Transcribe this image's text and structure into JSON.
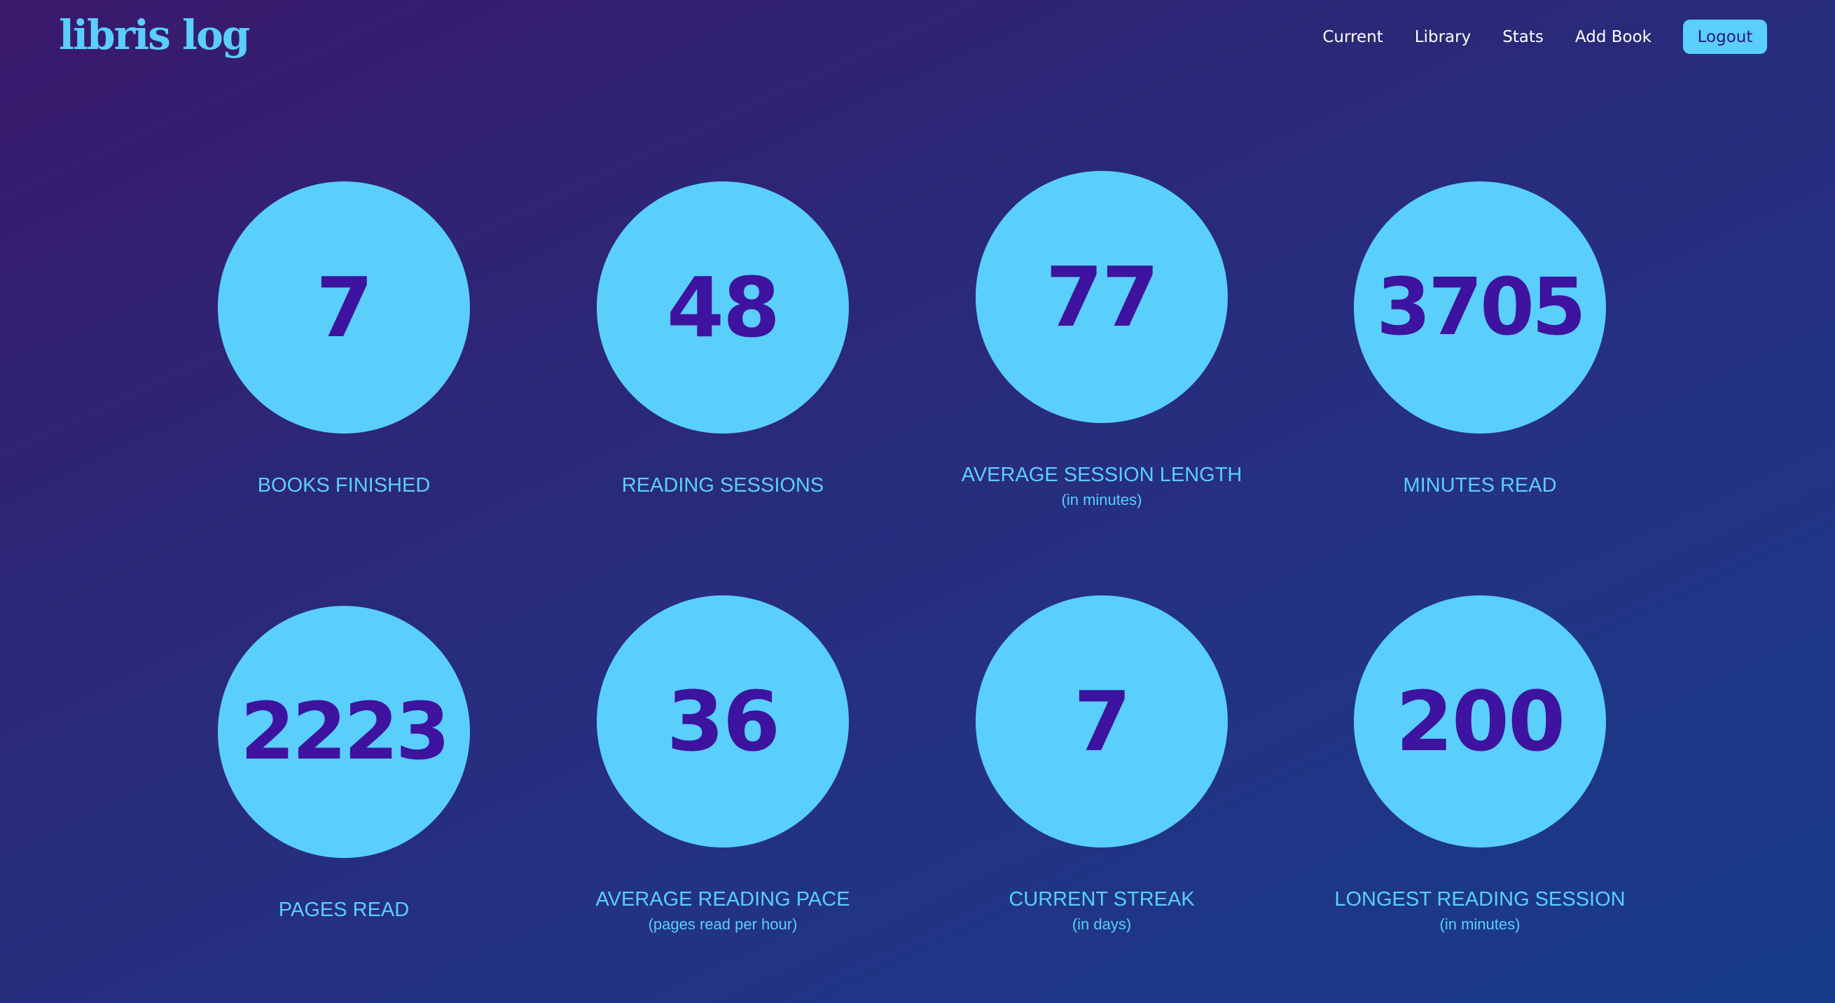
{
  "app": {
    "logo": "libris log"
  },
  "nav": {
    "items": [
      "Current",
      "Library",
      "Stats",
      "Add Book"
    ],
    "logout_label": "Logout"
  },
  "stats": [
    {
      "value": "7",
      "label": "BOOKS FINISHED",
      "sub": ""
    },
    {
      "value": "48",
      "label": "READING SESSIONS",
      "sub": ""
    },
    {
      "value": "77",
      "label": "AVERAGE SESSION LENGTH",
      "sub": "(in minutes)"
    },
    {
      "value": "3705",
      "label": "MINUTES READ",
      "sub": ""
    },
    {
      "value": "2223",
      "label": "PAGES READ",
      "sub": ""
    },
    {
      "value": "36",
      "label": "AVERAGE READING PACE",
      "sub": "(pages read per hour)"
    },
    {
      "value": "7",
      "label": "CURRENT STREAK",
      "sub": "(in days)"
    },
    {
      "value": "200",
      "label": "LONGEST READING SESSION",
      "sub": "(in minutes)"
    }
  ],
  "colors": {
    "accent": "#5acffc",
    "value_text": "#3d13a0",
    "background_start": "#3a196c",
    "background_end": "#173c8a"
  }
}
